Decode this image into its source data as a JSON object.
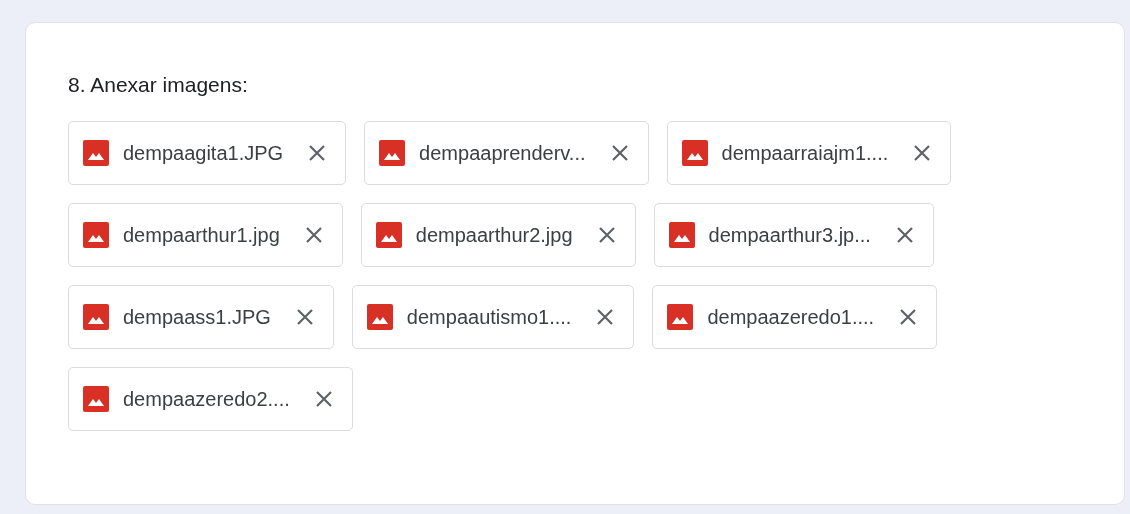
{
  "question": {
    "title": "8. Anexar imagens:"
  },
  "files": [
    {
      "name": "dempaagita1.JPG"
    },
    {
      "name": "dempaaprenderv..."
    },
    {
      "name": "dempaarraiajm1...."
    },
    {
      "name": "dempaarthur1.jpg"
    },
    {
      "name": "dempaarthur2.jpg"
    },
    {
      "name": "dempaarthur3.jp..."
    },
    {
      "name": "dempaass1.JPG"
    },
    {
      "name": "dempaautismo1...."
    },
    {
      "name": "dempaazeredo1...."
    },
    {
      "name": "dempaazeredo2...."
    }
  ]
}
